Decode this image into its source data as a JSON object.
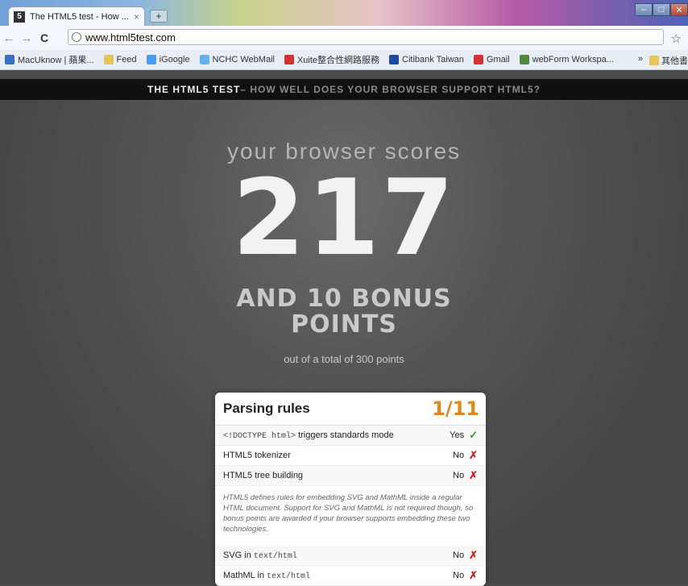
{
  "browser": {
    "tab_title": "The HTML5 test - How ...",
    "tab_favicon": "5",
    "tab_close": "×",
    "new_tab": "+",
    "window_buttons": [
      "–",
      "□",
      "✕"
    ],
    "nav": {
      "back": "←",
      "forward": "→",
      "reload": "C"
    },
    "url": "www.html5test.com",
    "star_icon": "☆",
    "bookmarks": [
      {
        "label": "MacUknow | 蘋果...",
        "color": "#3b6fc2"
      },
      {
        "label": "Feed",
        "color": "#e6c45a"
      },
      {
        "label": "iGoogle",
        "color": "#4c9be8"
      },
      {
        "label": "NCHC WebMail",
        "color": "#6ab0e8"
      },
      {
        "label": "Xuite整合性網路服務",
        "color": "#d23232"
      },
      {
        "label": "Citibank Taiwan",
        "color": "#1b4aa0"
      },
      {
        "label": "Gmail",
        "color": "#d23232"
      },
      {
        "label": "webForm Workspa...",
        "color": "#4f8a3c"
      }
    ],
    "bookmarks_overflow": "»",
    "bookmarks_other": "其他書"
  },
  "site": {
    "header_strong": "THE HTML5 TEST",
    "header_rest": " – HOW WELL DOES YOUR BROWSER SUPPORT HTML5?",
    "score_title": "your browser scores",
    "score": "217",
    "bonus_line1": "AND 10 BONUS",
    "bonus_line2": "POINTS",
    "total": "out of a total of 300 points"
  },
  "card": {
    "title": "Parsing rules",
    "score": "1/11",
    "rows": [
      {
        "code": "<!DOCTYPE html>",
        "label": " triggers standards mode",
        "result": "Yes",
        "pass": true
      },
      {
        "code": "",
        "label": "HTML5 tokenizer",
        "result": "No",
        "pass": false
      },
      {
        "code": "",
        "label": "HTML5 tree building",
        "result": "No",
        "pass": false
      }
    ],
    "note": "HTML5 defines rules for embedding SVG and MathML inside a regular HTML document. Support for SVG and MathML is not required though, so bonus points are awarded if your browser supports embedding these two technologies.",
    "rows2": [
      {
        "prefix": "SVG in ",
        "code": "text/html",
        "result": "No",
        "pass": false
      },
      {
        "prefix": "MathML in ",
        "code": "text/html",
        "result": "No",
        "pass": false
      }
    ],
    "yes_mark": "✓",
    "no_mark": "✗"
  }
}
